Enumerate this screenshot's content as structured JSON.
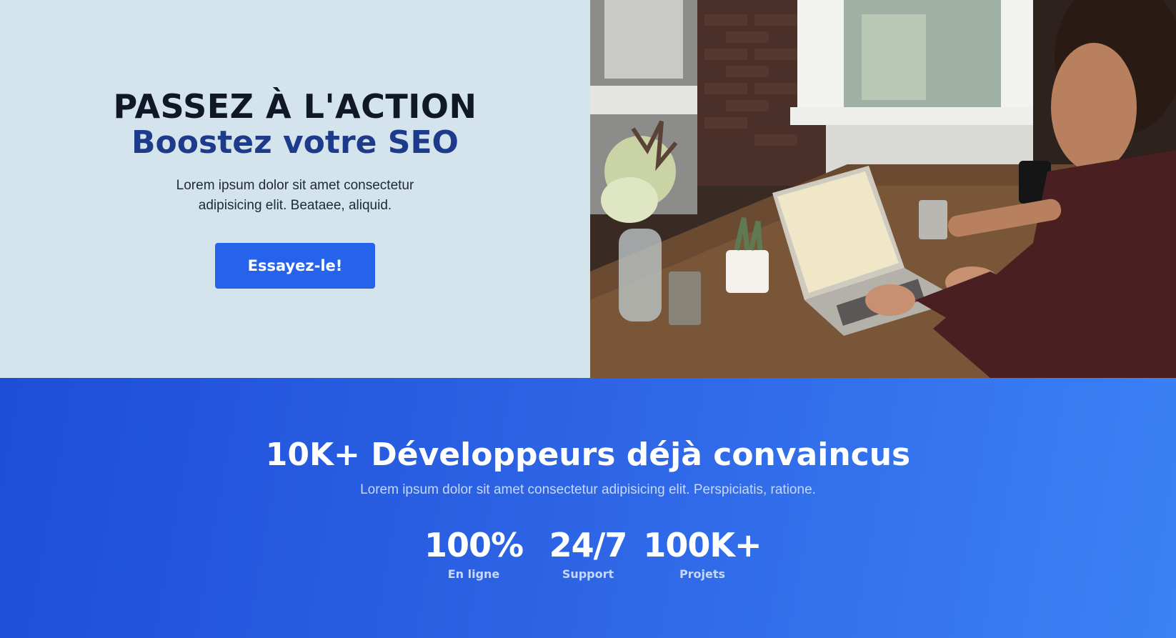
{
  "hero": {
    "title": "PASSEZ À L'ACTION",
    "subtitle": "Boostez votre SEO",
    "text": "Lorem ipsum dolor sit amet consectetur adipisicing elit. Beataee, aliquid.",
    "cta_label": "Essayez-le!"
  },
  "colors": {
    "hero_background": "#d3e4ec",
    "title": "#101828",
    "subtitle": "#1e3a8a",
    "button": "#2563eb",
    "stats_gradient_start": "#1d4ed8",
    "stats_gradient_end": "#3b82f6"
  },
  "stats": {
    "title": "10K+ Développeurs déjà convaincus",
    "text": "Lorem ipsum dolor sit amet consectetur adipisicing elit. Perspiciatis, ratione.",
    "items": [
      {
        "value": "100%",
        "label": "En ligne"
      },
      {
        "value": "24/7",
        "label": "Support"
      },
      {
        "value": "100K+",
        "label": "Projets"
      }
    ]
  }
}
